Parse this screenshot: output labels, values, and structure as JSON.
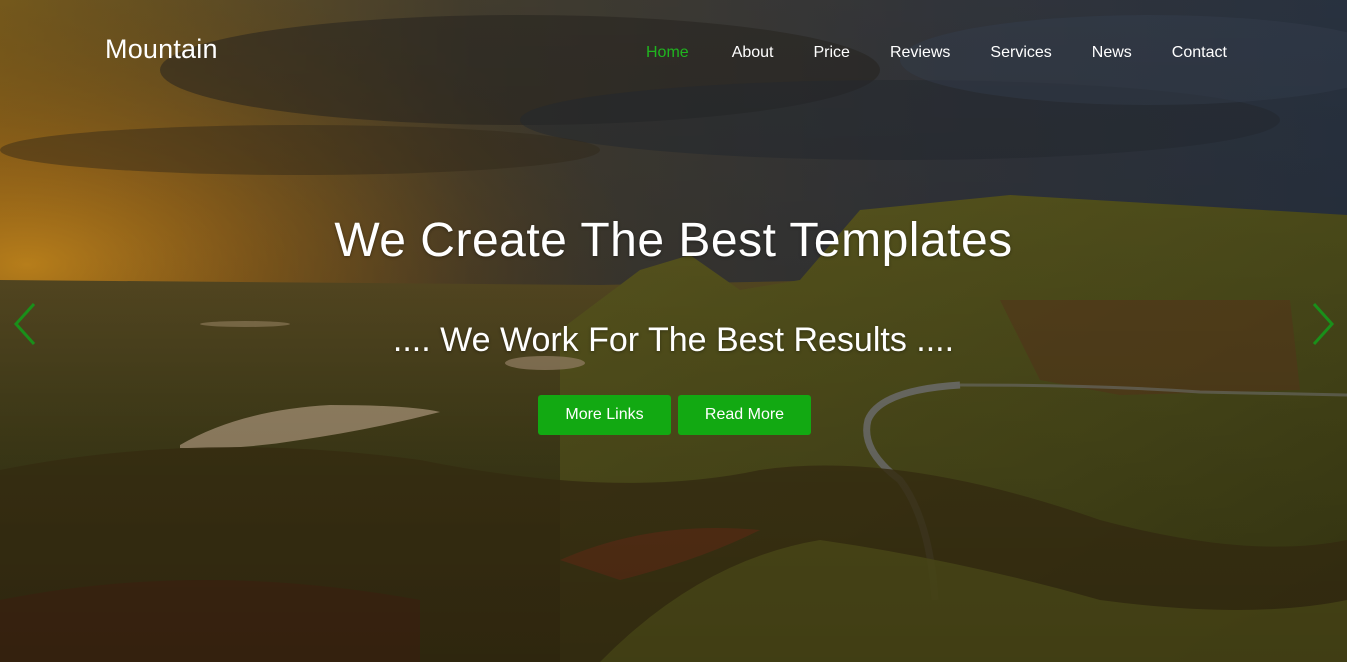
{
  "brand": {
    "name": "Mountain"
  },
  "nav": {
    "items": [
      {
        "label": "Home",
        "active": true
      },
      {
        "label": "About",
        "active": false
      },
      {
        "label": "Price",
        "active": false
      },
      {
        "label": "Reviews",
        "active": false
      },
      {
        "label": "Services",
        "active": false
      },
      {
        "label": "News",
        "active": false
      },
      {
        "label": "Contact",
        "active": false
      }
    ]
  },
  "hero": {
    "headline": "We Create The Best Templates",
    "subline": ".... We Work For The Best Results ....",
    "buttons": {
      "more_links": "More Links",
      "read_more": "Read More"
    }
  },
  "icons": {
    "prev": "chevron-left-icon",
    "next": "chevron-right-icon"
  },
  "colors": {
    "accent": "#12a912",
    "nav_active": "#1fb51f",
    "arrow": "#1a8f1a"
  }
}
